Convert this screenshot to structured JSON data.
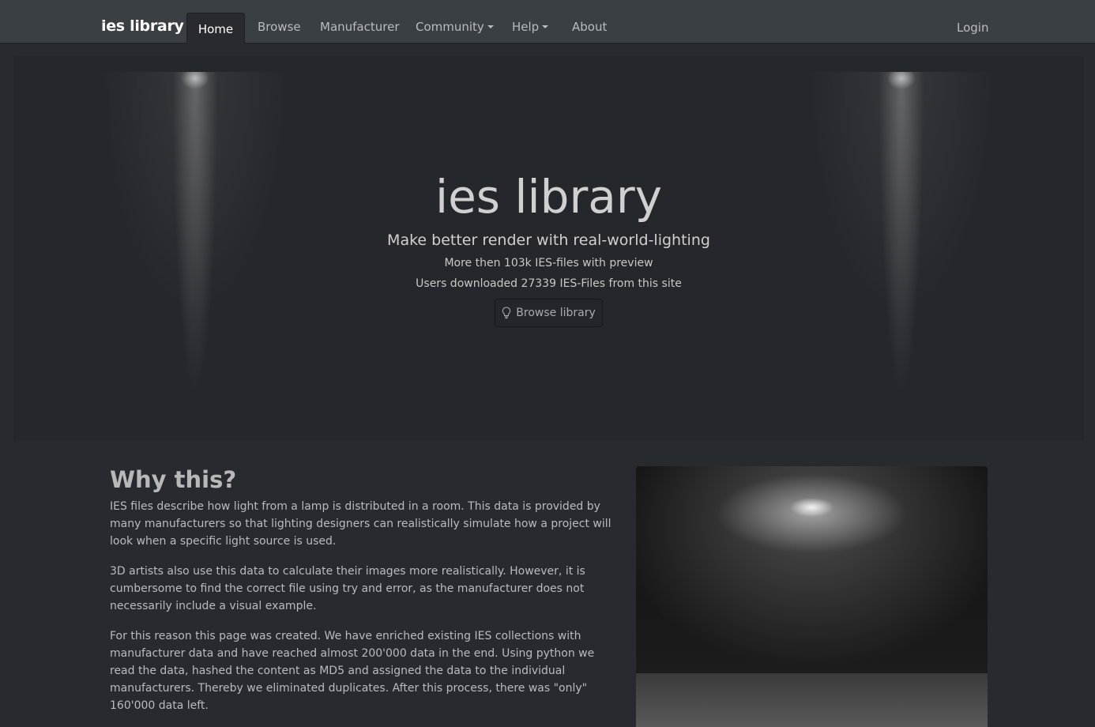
{
  "nav": {
    "brand": "ies library",
    "items": [
      {
        "label": "Home",
        "active": true
      },
      {
        "label": "Browse"
      },
      {
        "label": "Manufacturer"
      },
      {
        "label": "Community",
        "dropdown": true
      },
      {
        "label": "Help",
        "dropdown": true
      },
      {
        "label": "About"
      }
    ],
    "login": "Login"
  },
  "hero": {
    "title": "ies library",
    "subtitle": "Make better render with real-world-lighting",
    "line1": "More then 103k IES-files with preview",
    "line2": "Users downloaded 27339 IES-Files from this site",
    "button_label": "Browse library",
    "button_icon": "lightbulb-icon"
  },
  "why": {
    "title": "Why this?",
    "paragraphs": [
      "IES files describe how light from a lamp is distributed in a room. This data is provided by many manufacturers so that lighting designers can realistically simulate how a project will look when a specific light source is used.",
      "3D artists also use this data to calculate their images more realistically. However, it is cumbersome to find the correct file using try and error, as the manufacturer does not necessarily include a visual example.",
      "For this reason this page was created. We have enriched existing IES collections with manufacturer data and have reached almost 200'000 data in the end. Using python we read the data, hashed the content as MD5 and assigned the data to the individual manufacturers. Thereby we eliminated duplicates. After this process, there was \"only\" 160'000 data left."
    ]
  },
  "colors": {
    "page_bg": "#272b30",
    "navbar_bg": "#3a3f44",
    "hero_bg": "#24282c"
  }
}
